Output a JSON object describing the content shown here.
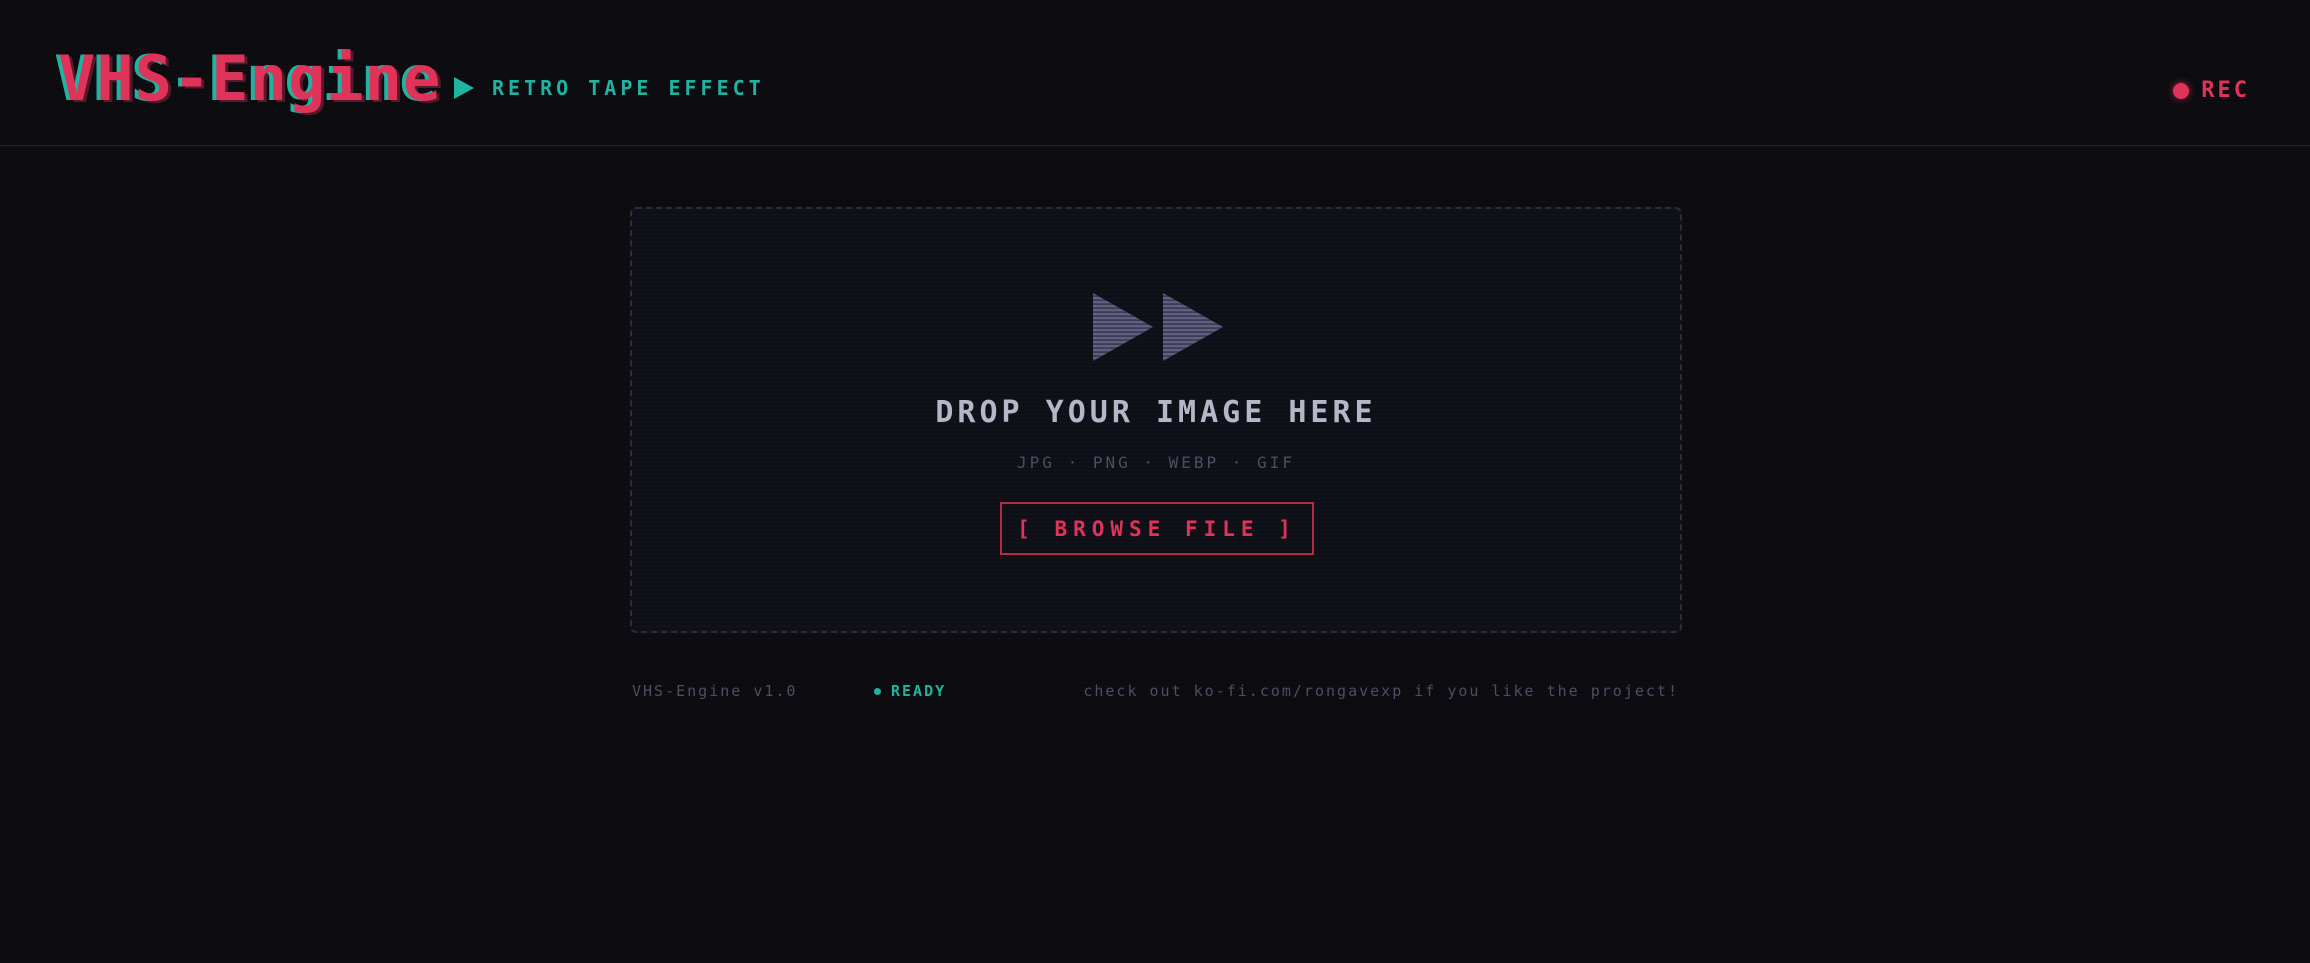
{
  "header": {
    "logo": "VHS-Engine",
    "subtitle": "RETRO TAPE EFFECT",
    "rec_label": "REC"
  },
  "dropzone": {
    "icon": "fast-forward-icon",
    "title": "DROP YOUR IMAGE HERE",
    "formats": "JPG · PNG · WEBP · GIF",
    "browse_label": "[ BROWSE FILE ]"
  },
  "footer": {
    "version": "VHS-Engine v1.0",
    "status": "READY",
    "link_text": "check out ko-fi.com/rongavexp if you like the project!"
  },
  "colors": {
    "background": "#0b0b10",
    "accent_red": "#e0335a",
    "accent_teal": "#1fb3a0",
    "muted_text": "#4d4e62",
    "icon_fill": "#5f5f82"
  }
}
